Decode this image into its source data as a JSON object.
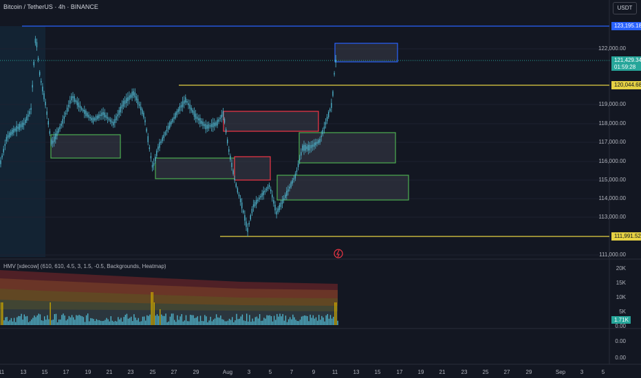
{
  "header": {
    "title": "Bitcoin / TetherUS · 4h · BINANCE",
    "currency_button": "USDT"
  },
  "colors": {
    "background": "#131722",
    "candle": "#4fb4cc",
    "blue_line": "#2962ff",
    "yellow_line": "#e6d243",
    "green_zone": "#4caf50",
    "red_zone": "#f23645",
    "current_price_tag": "#26a69a",
    "volume_bar": "#4fb4cc",
    "highlight_bar": "#c8a400"
  },
  "price_axis": {
    "ticks": [
      "122,000.00",
      "119,000.00",
      "118,000.00",
      "117,000.00",
      "116,000.00",
      "115,000.00",
      "114,000.00",
      "113,000.00",
      "111,000.00"
    ],
    "tags": {
      "high": "123,195.18",
      "current_price": "121,429.34",
      "countdown": "01:59:28",
      "level_mid": "120,044.68",
      "level_low": "111,991.52"
    }
  },
  "indicator": {
    "label": "HMV [xdecow] (610, 610, 4.5, 3, 1.5, -0.5, Backgrounds, Heatmap)",
    "ticks": [
      "20K",
      "15K",
      "10K",
      "5K"
    ],
    "current_value": "1.71K"
  },
  "lower_pane": {
    "ticks": [
      "0.00",
      "0.00",
      "0.00"
    ]
  },
  "time_axis": {
    "labels": [
      "11",
      "13",
      "15",
      "17",
      "19",
      "21",
      "23",
      "25",
      "27",
      "29",
      "Aug",
      "3",
      "5",
      "7",
      "9",
      "11",
      "13",
      "15",
      "17",
      "19",
      "21",
      "23",
      "25",
      "27",
      "29",
      "Sep",
      "3",
      "5"
    ]
  }
}
